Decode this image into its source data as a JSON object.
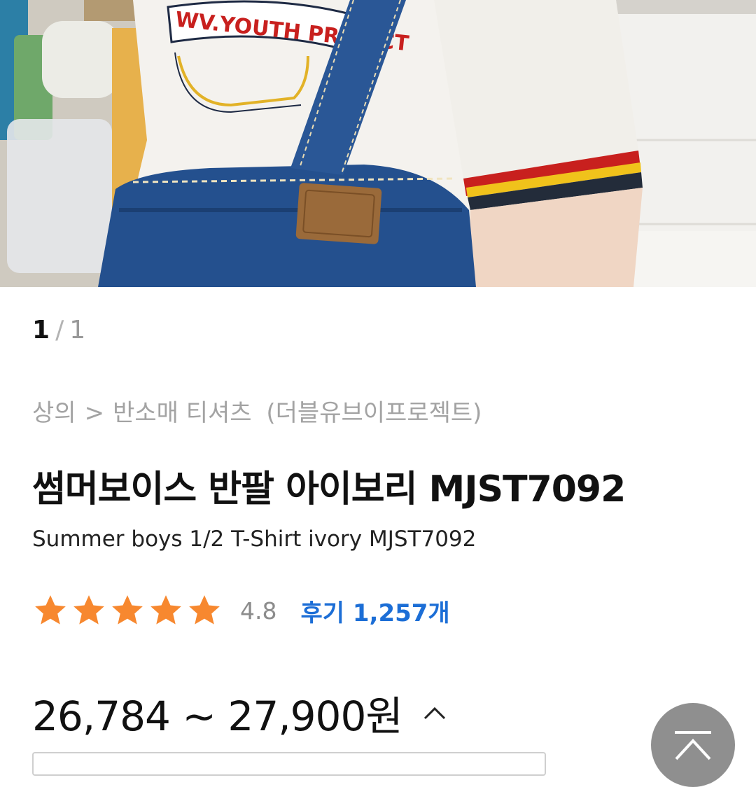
{
  "gallery": {
    "current": "1",
    "separator": "/",
    "total": "1",
    "image_description_icon": "product-photo"
  },
  "breadcrumb": {
    "category": "상의",
    "separator": ">",
    "subcategory": "반소매 티셔츠",
    "brand": "(더블유브이프로젝트)"
  },
  "product": {
    "title": "썸머보이스 반팔 아이보리 MJST7092",
    "subtitle": "Summer boys 1/2 T-Shirt ivory MJST7092"
  },
  "rating": {
    "stars": 5,
    "value": "4.8",
    "reviews_label": "후기 1,257개",
    "star_color": "#f7882f",
    "review_color": "#1c6ed6"
  },
  "price": {
    "range": "26,784 ~ 27,900원",
    "toggle_icon": "chevron-up-icon"
  },
  "scroll_top": {
    "icon": "scroll-to-top-icon"
  }
}
